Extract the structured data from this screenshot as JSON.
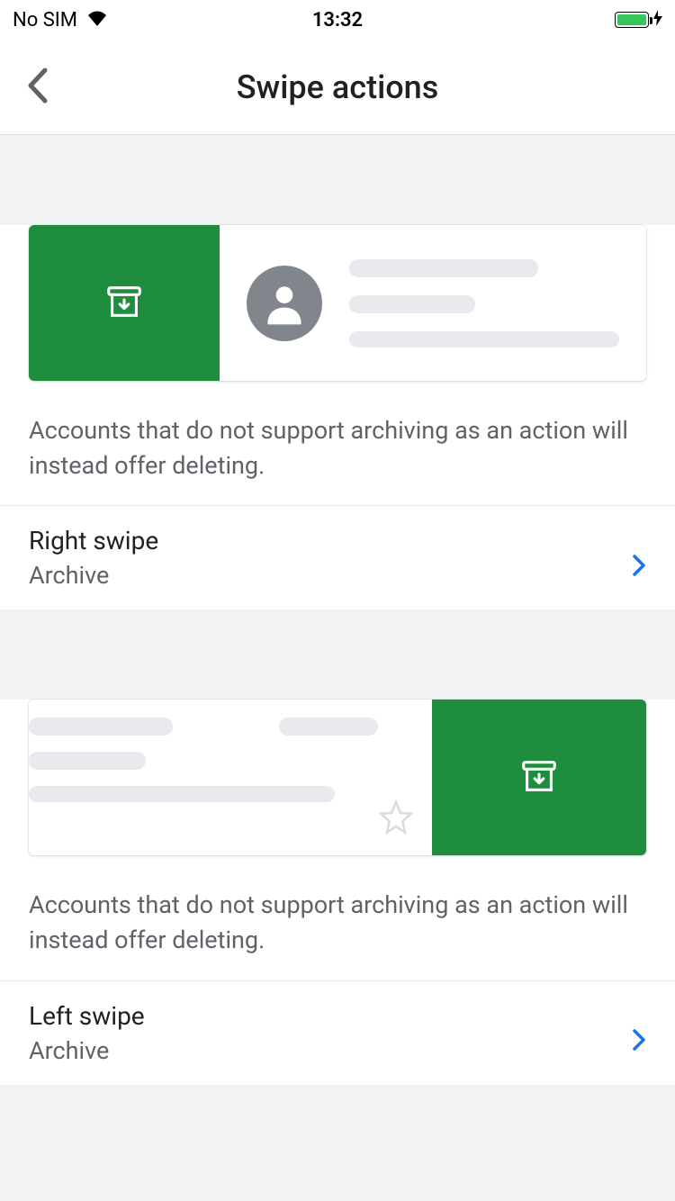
{
  "status": {
    "carrier": "No SIM",
    "time": "13:32"
  },
  "nav": {
    "title": "Swipe actions"
  },
  "sections": {
    "right": {
      "description": "Accounts that do not support archiving as an action will instead offer deleting.",
      "label": "Right swipe",
      "value": "Archive"
    },
    "left": {
      "description": "Accounts that do not support archiving as an action will instead offer deleting.",
      "label": "Left swipe",
      "value": "Archive"
    }
  },
  "colors": {
    "swipe_action": "#1e8e3e",
    "chevron_disclosure": "#1a73e8"
  }
}
